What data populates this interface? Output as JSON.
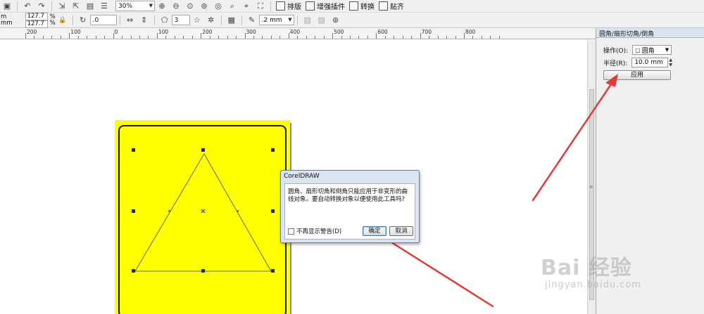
{
  "toolbar_top": {
    "zoom_value": "30%",
    "menu_items": [
      {
        "label": "排版"
      },
      {
        "label": "增强插件"
      },
      {
        "label": "转换"
      },
      {
        "label": "贴齐"
      }
    ]
  },
  "toolbar_props": {
    "size_unit": "m",
    "size_unit2": "mm",
    "width_value": "127.7",
    "height_value": "127.7",
    "pct1": "%",
    "pct2": "%",
    "rotation_value": ".0",
    "points_value": "3",
    "outline_value": ".2 mm"
  },
  "ruler": {
    "labels": [
      "200",
      "100",
      "0",
      "100",
      "200",
      "300",
      "400",
      "500",
      "600",
      "700",
      "800"
    ]
  },
  "docker": {
    "title": "圆角/扇形切角/倒角",
    "operation_label": "操作(O):",
    "operation_value": "圆角",
    "radius_label": "半径(R):",
    "radius_value": "10.0 mm",
    "apply_label": "应用"
  },
  "dialog": {
    "title": "CorelDRAW",
    "message": "圆角、扇形切角和倒角只能应用于非变形的曲线对象。要自动转换对象以便使用此工具吗?",
    "dont_show_label": "不再显示警告(D)",
    "ok_label": "确定",
    "cancel_label": "取消"
  },
  "watermark": {
    "logo_text": "Bai 经验",
    "url_text": "jingyan.baidu.com"
  },
  "colors": {
    "page_fill": "#ffff00",
    "arrow": "#e53935",
    "dialog_frame": "#dbe5f2"
  }
}
